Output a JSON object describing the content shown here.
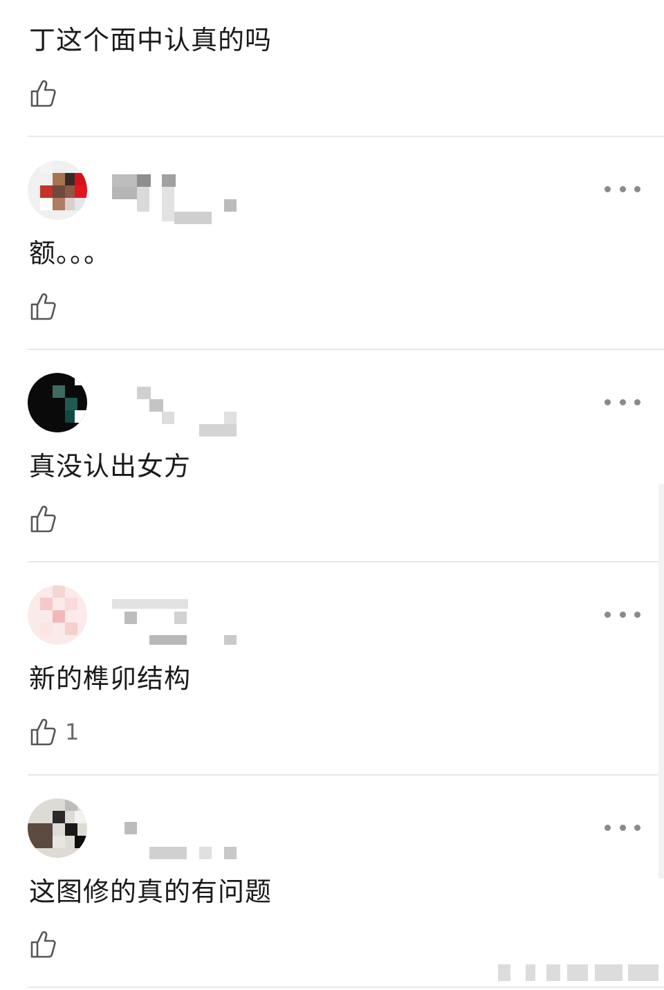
{
  "comments": [
    {
      "text": "丁这个面中认真的吗",
      "likes": ""
    },
    {
      "text": "额。。。",
      "likes": ""
    },
    {
      "text": "真没认出女方",
      "likes": ""
    },
    {
      "text": "新的榫卯结构",
      "likes": "1"
    },
    {
      "text": "这图修的真的有问题",
      "likes": ""
    }
  ],
  "icons": {
    "like": "thumbs-up-icon",
    "more": "more-horizontal-icon"
  },
  "colors": {
    "text": "#1a1a1a",
    "divider": "#e8e8e8",
    "icon": "#555555",
    "dots": "#8a8a8a"
  }
}
